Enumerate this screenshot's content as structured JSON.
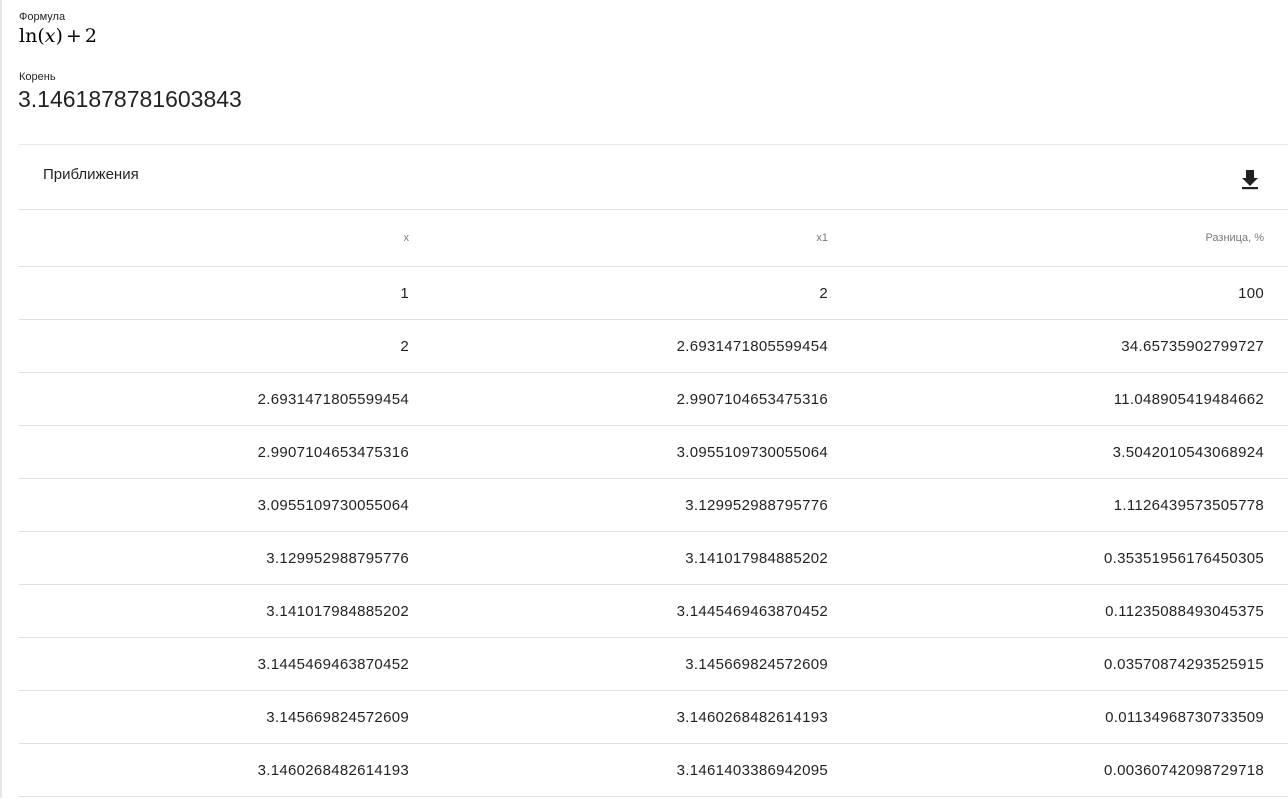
{
  "formula": {
    "label": "Формула",
    "fn": "ln",
    "open": "(",
    "var": "x",
    "close": ")",
    "op": "+",
    "const": "2"
  },
  "root": {
    "label": "Корень",
    "value": "3.1461878781603843"
  },
  "approximations": {
    "title": "Приближения",
    "download_icon": "download-icon",
    "columns": [
      "x",
      "x1",
      "Разница, %"
    ],
    "rows": [
      [
        "1",
        "2",
        "100"
      ],
      [
        "2",
        "2.6931471805599454",
        "34.65735902799727"
      ],
      [
        "2.6931471805599454",
        "2.9907104653475316",
        "11.048905419484662"
      ],
      [
        "2.9907104653475316",
        "3.0955109730055064",
        "3.5042010543068924"
      ],
      [
        "3.0955109730055064",
        "3.129952988795776",
        "1.1126439573505778"
      ],
      [
        "3.129952988795776",
        "3.141017984885202",
        "0.35351956176450305"
      ],
      [
        "3.141017984885202",
        "3.1445469463870452",
        "0.11235088493045375"
      ],
      [
        "3.1445469463870452",
        "3.145669824572609",
        "0.03570874293525915"
      ],
      [
        "3.145669824572609",
        "3.1460268482614193",
        "0.01134968730733509"
      ],
      [
        "3.1460268482614193",
        "3.1461403386942095",
        "0.00360742098729718"
      ]
    ]
  }
}
